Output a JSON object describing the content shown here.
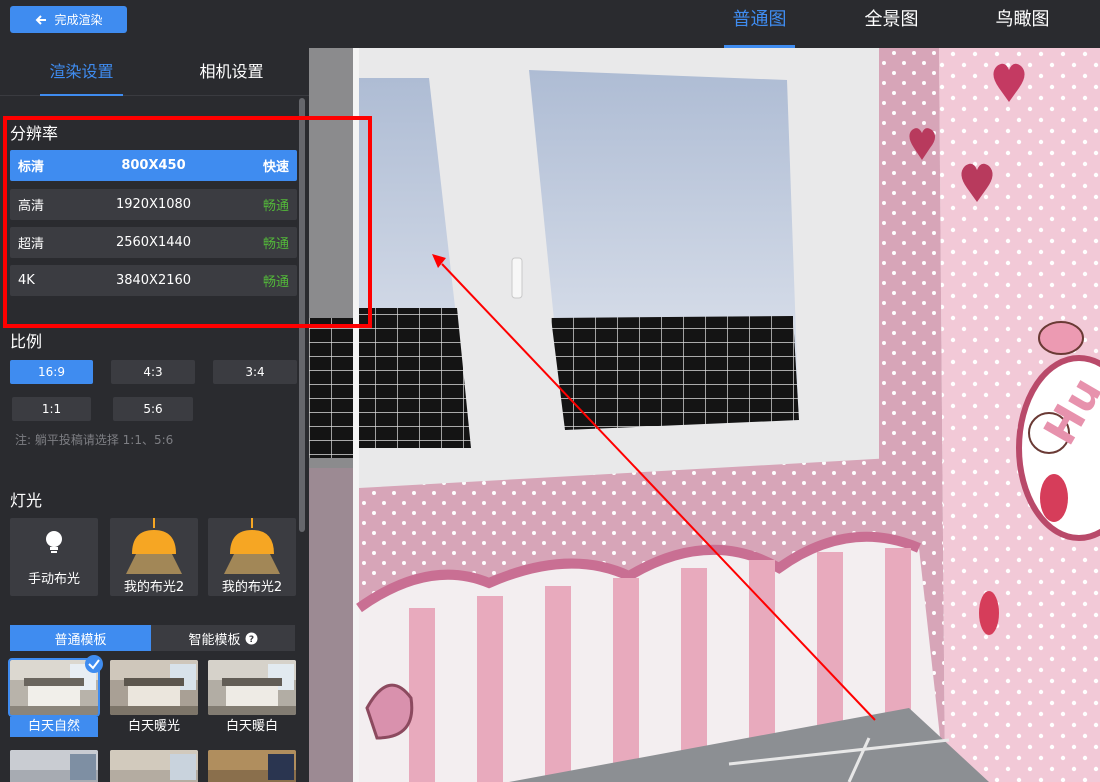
{
  "topbar": {
    "back_label": "完成渲染",
    "views": [
      "普通图",
      "全景图",
      "鸟瞰图"
    ]
  },
  "sidebar": {
    "tabs": [
      "渲染设置",
      "相机设置"
    ],
    "resolution": {
      "title": "分辨率",
      "rows": [
        {
          "quality": "标清",
          "size": "800X450",
          "speed": "快速"
        },
        {
          "quality": "高清",
          "size": "1920X1080",
          "speed": "畅通"
        },
        {
          "quality": "超清",
          "size": "2560X1440",
          "speed": "畅通"
        },
        {
          "quality": "4K",
          "size": "3840X2160",
          "speed": "畅通"
        }
      ]
    },
    "ratio": {
      "title": "比例",
      "options": [
        "16:9",
        "4:3",
        "3:4",
        "1:1",
        "5:6"
      ],
      "note": "注: 躺平投稿请选择 1:1、5:6"
    },
    "light": {
      "title": "灯光",
      "cards": [
        "手动布光",
        "我的布光2",
        "我的布光2"
      ]
    },
    "templates": {
      "tabs": [
        "普通模板",
        "智能模板"
      ],
      "items": [
        "白天自然",
        "白天暖光",
        "白天暖白"
      ]
    }
  },
  "colors": {
    "accent": "#3f8cf0",
    "panel": "#2a2b2f",
    "row": "#3b3c41",
    "speed_green": "#53b83a",
    "highlight_red": "#ff0000"
  }
}
